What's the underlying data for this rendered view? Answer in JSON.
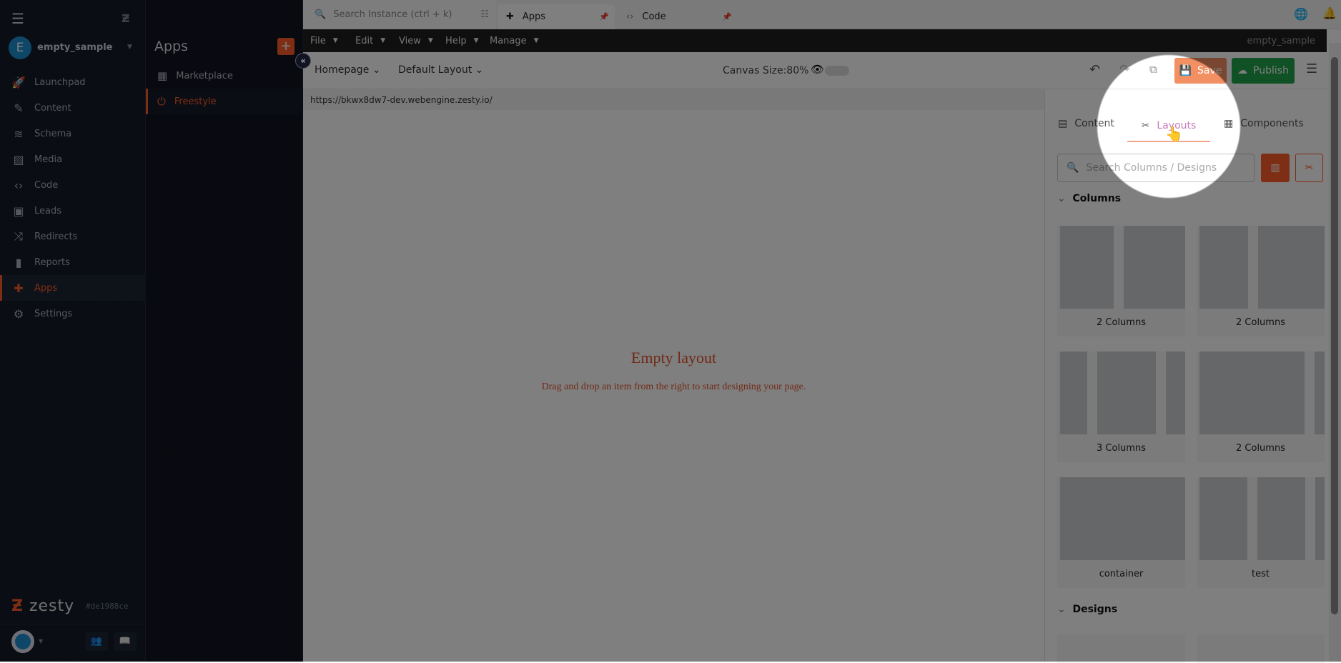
{
  "sidebar": {
    "instance_initial": "E",
    "instance_name": "empty_sample",
    "items": [
      {
        "label": "Launchpad",
        "icon": "rocket-icon"
      },
      {
        "label": "Content",
        "icon": "pencil-icon"
      },
      {
        "label": "Schema",
        "icon": "database-icon"
      },
      {
        "label": "Media",
        "icon": "image-icon"
      },
      {
        "label": "Code",
        "icon": "code-icon"
      },
      {
        "label": "Leads",
        "icon": "contact-icon"
      },
      {
        "label": "Redirects",
        "icon": "redirect-icon"
      },
      {
        "label": "Reports",
        "icon": "bar-chart-icon"
      },
      {
        "label": "Apps",
        "icon": "puzzle-icon",
        "active": true
      },
      {
        "label": "Settings",
        "icon": "gear-icon"
      }
    ],
    "logo": "zesty",
    "commit": "#de1988ce"
  },
  "apps_panel": {
    "title": "Apps",
    "items": [
      {
        "label": "Marketplace"
      },
      {
        "label": "Freestyle",
        "active": true
      }
    ]
  },
  "topbar": {
    "search_placeholder": "Search Instance (ctrl + k)",
    "tabs": [
      {
        "label": "Apps"
      },
      {
        "label": "Code"
      }
    ]
  },
  "menubar": {
    "items": [
      "File",
      "Edit",
      "View",
      "Help",
      "Manage"
    ],
    "instance": "empty_sample"
  },
  "toolbar": {
    "page": "Homepage",
    "layout": "Default Layout",
    "canvas_size": "Canvas Size:80%",
    "save": "Save",
    "publish": "Publish"
  },
  "url": "https://bkwx8dw7-dev.webengine.zesty.io/",
  "canvas": {
    "title": "Empty layout",
    "subtitle": "Drag and drop an item from the right to start designing your page."
  },
  "right_panel": {
    "tabs": [
      {
        "label": "Content"
      },
      {
        "label": "Layouts",
        "active": true
      },
      {
        "label": "Components"
      }
    ],
    "search_placeholder": "Search Columns / Designs",
    "columns_header": "Columns",
    "cards": [
      {
        "label": "2 Columns"
      },
      {
        "label": "2 Columns"
      },
      {
        "label": "3 Columns"
      },
      {
        "label": "2 Columns"
      },
      {
        "label": "container"
      },
      {
        "label": "test"
      }
    ],
    "designs_header": "Designs"
  },
  "colors": {
    "accent": "#ff5d2b",
    "publish": "#1fa34a",
    "sidebar": "#131a27"
  }
}
